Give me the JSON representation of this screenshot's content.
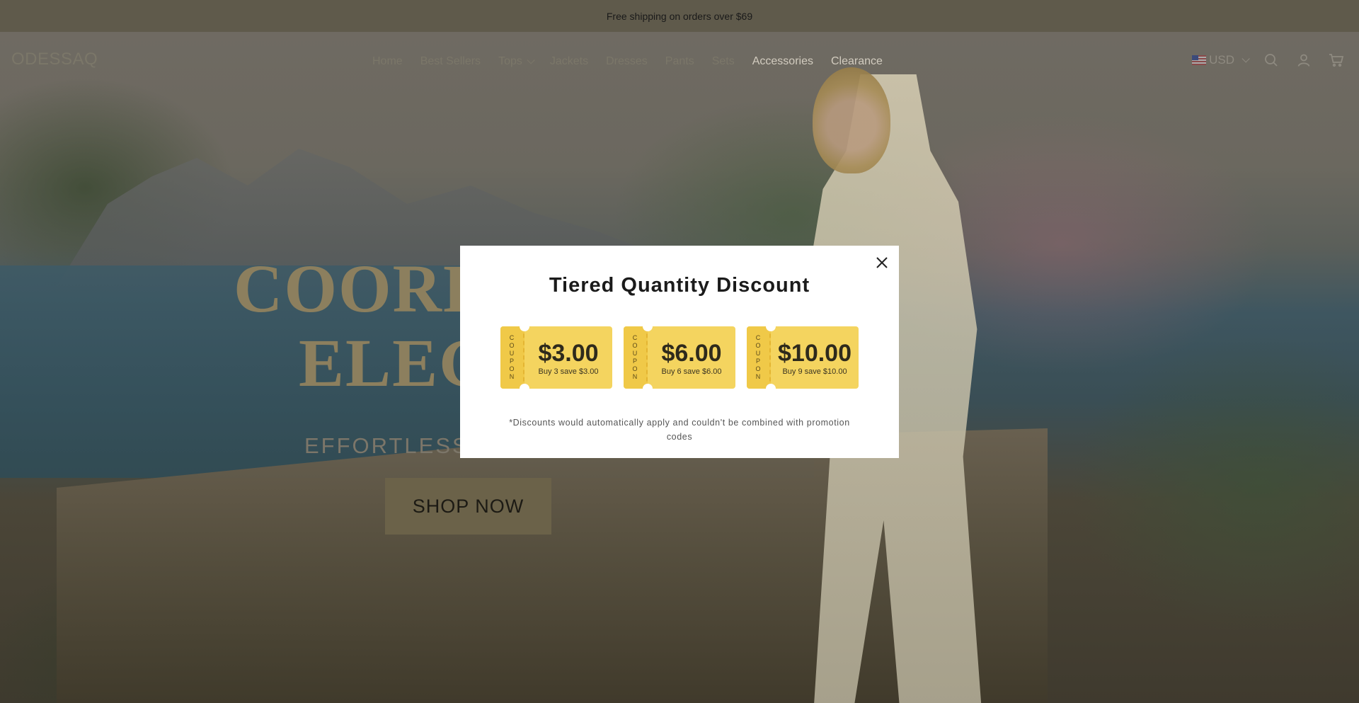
{
  "announcement": "Free shipping on orders over $69",
  "header": {
    "logo": "ODESSAQ",
    "nav": [
      {
        "label": "Home",
        "dropdown": false
      },
      {
        "label": "Best Sellers",
        "dropdown": false
      },
      {
        "label": "Tops",
        "dropdown": true
      },
      {
        "label": "Jackets",
        "dropdown": false
      },
      {
        "label": "Dresses",
        "dropdown": false
      },
      {
        "label": "Pants",
        "dropdown": false
      },
      {
        "label": "Sets",
        "dropdown": false
      },
      {
        "label": "Accessories",
        "dropdown": false
      },
      {
        "label": "Clearance",
        "dropdown": false
      }
    ],
    "currency": "USD",
    "icons": [
      "search-icon",
      "account-icon",
      "cart-icon"
    ]
  },
  "hero": {
    "title_line1": "COORD",
    "title_line2": "ELEG",
    "subtitle": "EFFORTLESSLY",
    "button": "SHOP NOW"
  },
  "modal": {
    "title": "Tiered Quantity Discount",
    "coupon_stub_label": "COUPON",
    "coupons": [
      {
        "amount": "$3.00",
        "desc": "Buy 3 save $3.00"
      },
      {
        "amount": "$6.00",
        "desc": "Buy 6 save $6.00"
      },
      {
        "amount": "$10.00",
        "desc": "Buy 9 save $10.00"
      }
    ],
    "note": "*Discounts would automatically apply and couldn't be combined with promotion codes"
  },
  "colors": {
    "coupon": "#f4d45f",
    "overlay_dim": "#5f5a4b"
  }
}
